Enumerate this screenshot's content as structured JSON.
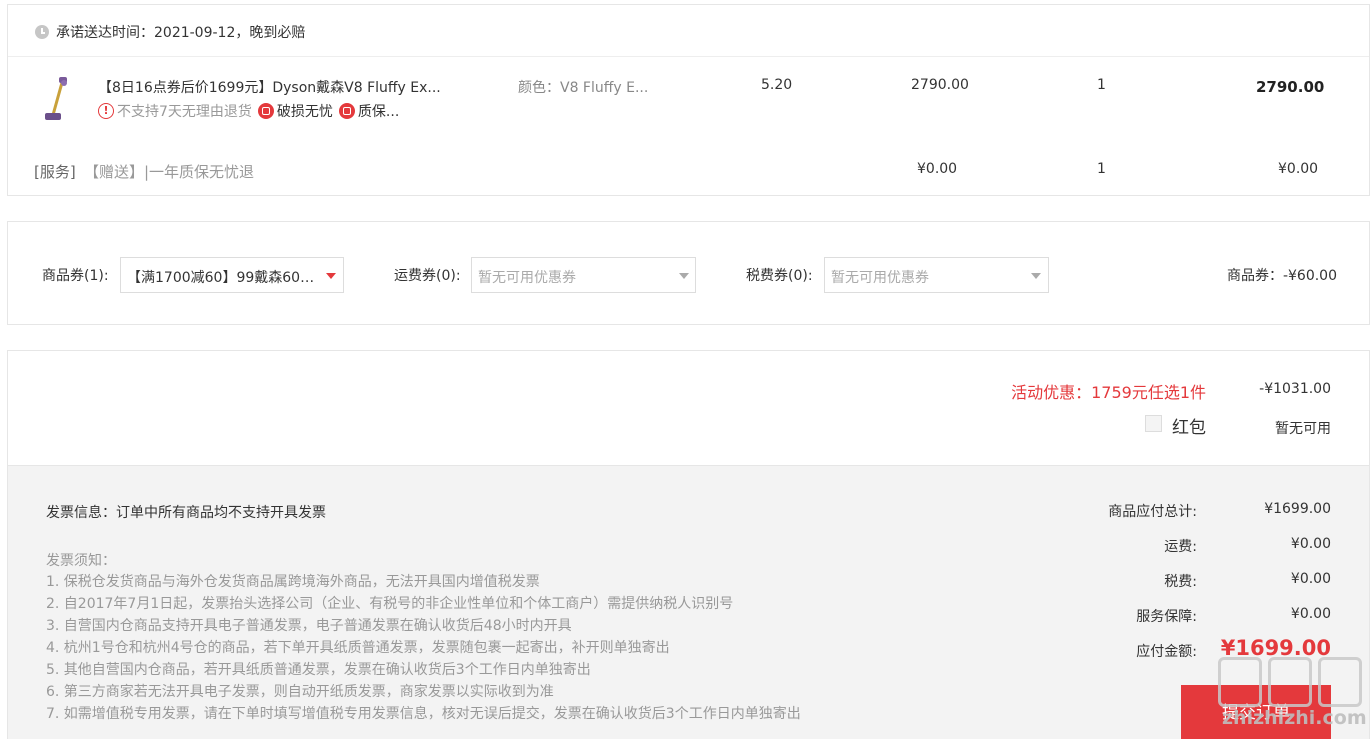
{
  "delivery": {
    "text": "承诺送达时间：2021-09-12，晚到必赔"
  },
  "product": {
    "title": "【8日16点券后价1699元】Dyson戴森V8 Fluffy Ex...",
    "color": "颜色：V8 Fluffy E...",
    "tax": "5.20",
    "price": "2790.00",
    "qty": "1",
    "total": "2790.00",
    "tags": {
      "no_return": "不支持7天无理由退货",
      "damage": "破损无忧",
      "warranty": "质保..."
    }
  },
  "service": {
    "label": "[服务]",
    "gift": "【赠送】|一年质保无忧退",
    "price": "¥0.00",
    "qty": "1",
    "total": "¥0.00"
  },
  "coupons": {
    "goods_label": "商品券(1):",
    "goods_selected": "【满1700减60】99戴森60元...",
    "shipping_label": "运费券(0):",
    "shipping_placeholder": "暂无可用优惠券",
    "tax_label": "税费券(0):",
    "tax_placeholder": "暂无可用优惠券",
    "discount": "商品券：-¥60.00"
  },
  "promotions": {
    "activity": "活动优惠：1759元任选1件",
    "activity_amount": "-¥1031.00",
    "hongbao_label": "红包",
    "hongbao_status": "暂无可用"
  },
  "invoice": {
    "title": "发票信息：订单中所有商品均不支持开具发票",
    "notice_title": "发票须知：",
    "notices": [
      "1. 保税仓发货商品与海外仓发货商品属跨境海外商品，无法开具国内增值税发票",
      "2. 自2017年7月1日起，发票抬头选择公司（企业、有税号的非企业性单位和个体工商户）需提供纳税人识别号",
      "3. 自营国内仓商品支持开具电子普通发票，电子普通发票在确认收货后48小时内开具",
      "4. 杭州1号仓和杭州4号仓的商品，若下单开具纸质普通发票，发票随包裹一起寄出，补开则单独寄出",
      "5. 其他自营国内仓商品，若开具纸质普通发票，发票在确认收货后3个工作日内单独寄出",
      "6. 第三方商家若无法开具电子发票，则自动开纸质发票，商家发票以实际收到为准",
      "7. 如需增值税专用发票，请在下单时填写增值税专用发票信息，核对无误后提交，发票在确认收货后3个工作日内单独寄出"
    ]
  },
  "summary": {
    "goods_total_label": "商品应付总计:",
    "goods_total": "¥1699.00",
    "shipping_label": "运费:",
    "shipping": "¥0.00",
    "tax_label": "税费:",
    "tax": "¥0.00",
    "service_label": "服务保障:",
    "service": "¥0.00",
    "payable_label": "应付金额:",
    "payable": "¥1699.00"
  },
  "submit_label": "提交订单",
  "watermark": "zhizhizhi.com",
  "colors": {
    "accent": "#e4393c",
    "panel_bg": "#f3f3f3"
  }
}
